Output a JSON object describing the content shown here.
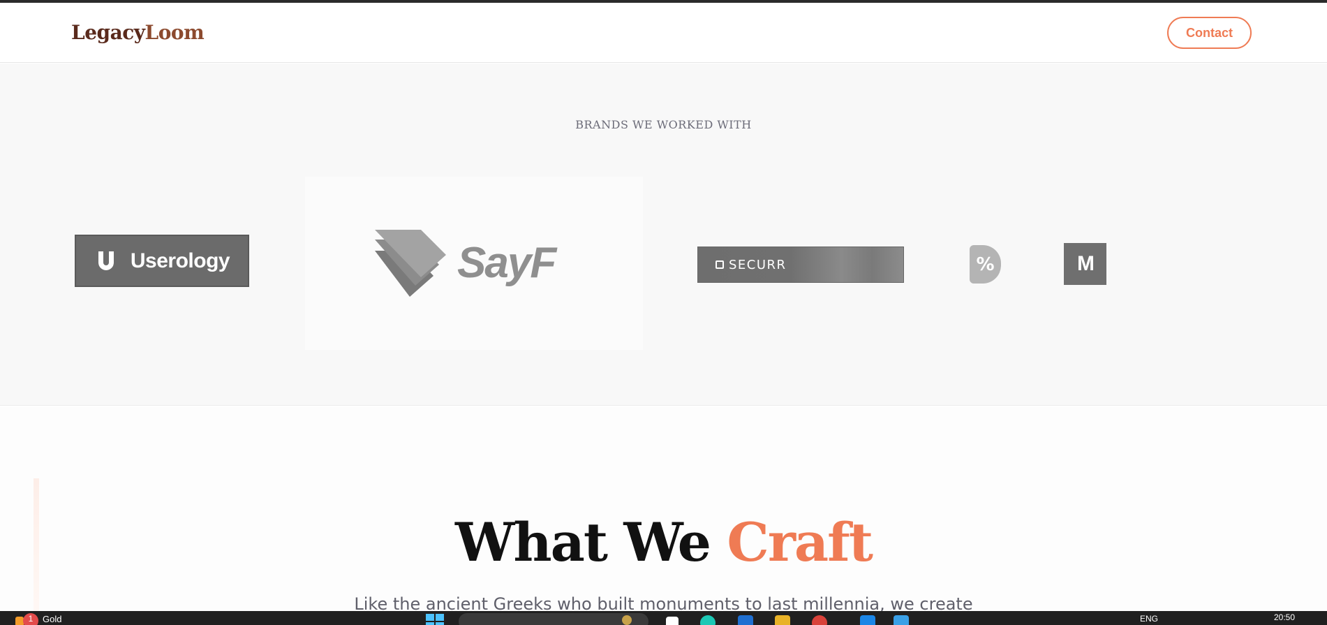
{
  "header": {
    "logo_part1": "Legacy",
    "logo_part2": "Loom",
    "contact_label": "Contact"
  },
  "brands": {
    "title": "BRANDS WE WORKED WITH",
    "logos": {
      "userology": "Userology",
      "sayf": "SayF",
      "securr": "SECURR",
      "mtv": "M"
    }
  },
  "craft": {
    "title_part1": "What We ",
    "title_part2": "Craft",
    "subtitle": "Like the ancient Greeks who built monuments to last millennia, we create"
  },
  "taskbar": {
    "badge_count": "1",
    "weather_label": "Gold",
    "language": "ENG",
    "time": "20:50"
  },
  "colors": {
    "accent": "#ef7b54",
    "logo_dark": "#5a2a1c",
    "logo_light": "#8c4a2e",
    "brands_bg": "#f8f8f8",
    "taskbar_bg": "#202020"
  },
  "icons": {
    "start": "windows-start-icon",
    "search": "taskbar-search-icon",
    "percent_logo": "percent-badge-icon"
  }
}
